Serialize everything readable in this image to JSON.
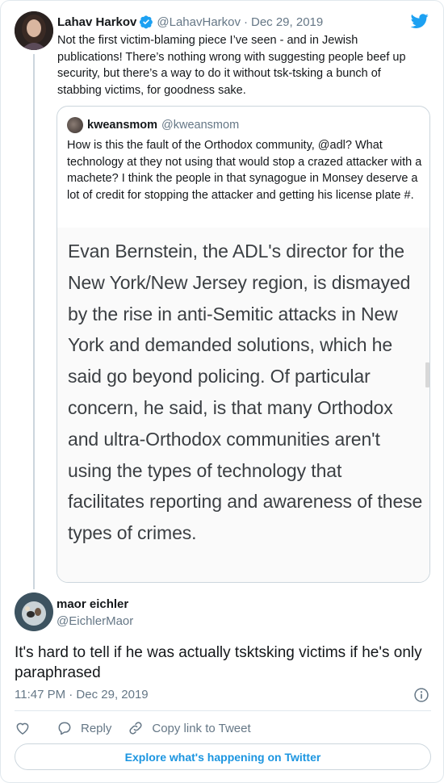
{
  "parent": {
    "name": "Lahav Harkov",
    "handle": "@LahavHarkov",
    "separator": "·",
    "date": "Dec 29, 2019",
    "text": "Not the first victim-blaming piece I’ve seen - and in Jewish publications! There’s nothing wrong with suggesting people beef up security, but there’s a way to do it without tsk-tsking a bunch of stabbing victims, for goodness sake."
  },
  "quote": {
    "name": "kweansmom",
    "handle": "@kweansmom",
    "text": "How is this the fault of the Orthodox community, @adl? What technology at they not using that would stop a crazed attacker with a machete? I think the people in that synagogue in Monsey deserve a lot of credit for stopping the attacker and getting his license plate #.",
    "media_text": "Evan Bernstein, the ADL's director for the New York/New Jersey region, is dismayed by the rise in anti-Semitic attacks in New York and demanded solutions, which he said go beyond policing. Of particular concern, he said, is that many Orthodox and ultra-Orthodox communities aren't using the types of technology that facilitates reporting and awareness of these types of crimes."
  },
  "reply": {
    "name": "maor eichler",
    "handle": "@EichlerMaor",
    "text": "It's hard to tell if he was actually tsktsking victims if he's only paraphrased",
    "timestamp": "11:47 PM · Dec 29, 2019"
  },
  "actions": {
    "reply_label": "Reply",
    "copy_label": "Copy link to Tweet"
  },
  "explore_label": "Explore what's happening on Twitter",
  "icons": {
    "verified": "verified-badge-icon",
    "brand": "twitter-bird-icon",
    "info": "info-icon",
    "like": "heart-icon",
    "reply": "speech-bubble-icon",
    "copy": "link-icon"
  },
  "colors": {
    "brand_blue": "#1da1f2",
    "link_blue": "#1b95e0",
    "secondary_text": "#657786",
    "border": "#ccd6dd"
  }
}
